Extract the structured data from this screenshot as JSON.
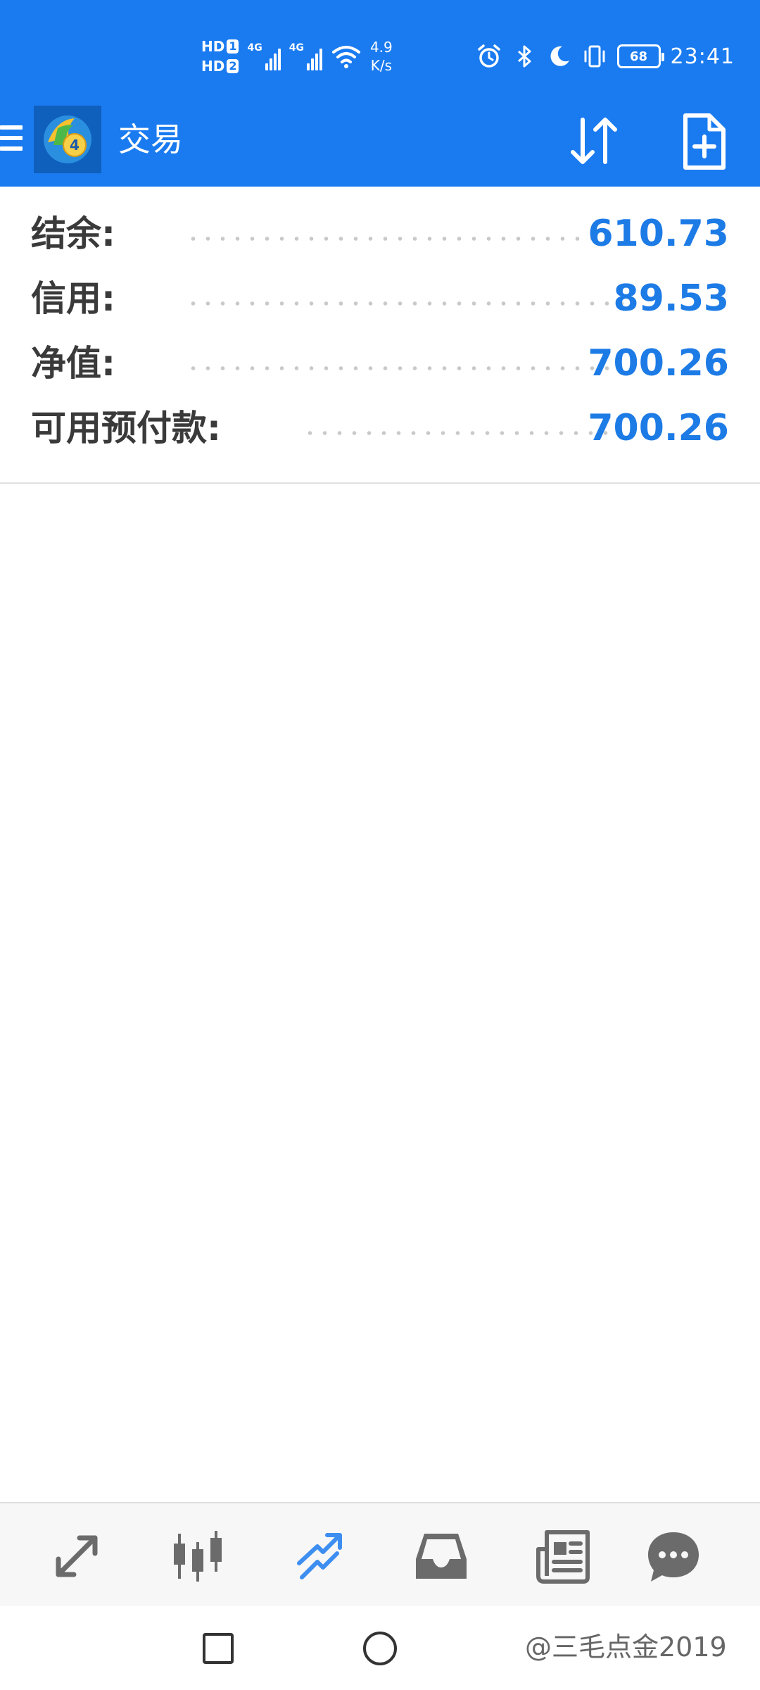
{
  "status_bar": {
    "hd1": "HD",
    "hd1_sim": "1",
    "hd2": "HD",
    "hd2_sim": "2",
    "net_type1": "4G",
    "net_type2": "4G",
    "speed_value": "4.9",
    "speed_unit": "K/s",
    "battery": "68",
    "time": "23:41",
    "icons": [
      "alarm-icon",
      "bluetooth-icon",
      "moon-icon",
      "vibrate-icon"
    ]
  },
  "app_bar": {
    "title": "交易",
    "icons": [
      "menu-icon",
      "app-logo",
      "sort-icon",
      "new-order-icon"
    ]
  },
  "account": {
    "rows": [
      {
        "label": "结余:",
        "value": "610.73"
      },
      {
        "label": "信用:",
        "value": "89.53"
      },
      {
        "label": "净值:",
        "value": "700.26"
      },
      {
        "label": "可用预付款:",
        "value": "700.26"
      }
    ]
  },
  "bottom_nav": {
    "items": [
      "quotes-icon",
      "chart-icon",
      "trade-icon",
      "history-icon",
      "news-icon",
      "chat-icon"
    ],
    "active": "trade-icon"
  },
  "system_nav": {
    "watermark": "@三毛点金2019"
  },
  "colors": {
    "brand_blue": "#1a7bf0",
    "value_blue": "#1d7be6",
    "active_tab": "#3d8ef0",
    "inactive_tab": "#6b6b6b"
  }
}
